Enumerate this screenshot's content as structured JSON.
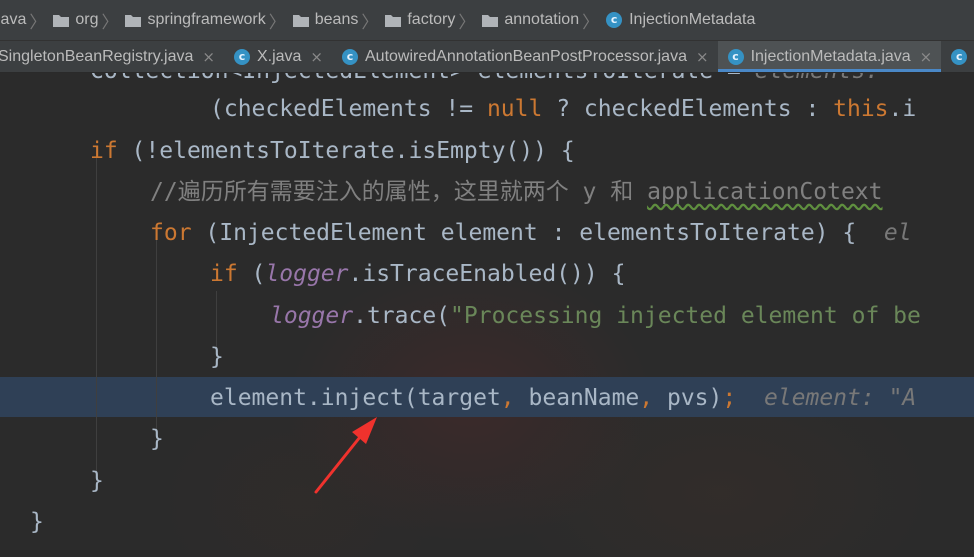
{
  "breadcrumb": {
    "items": [
      {
        "label": "java",
        "icon": "folder-icon"
      },
      {
        "label": "org",
        "icon": "folder-icon"
      },
      {
        "label": "springframework",
        "icon": "folder-icon"
      },
      {
        "label": "beans",
        "icon": "folder-icon"
      },
      {
        "label": "factory",
        "icon": "folder-icon"
      },
      {
        "label": "annotation",
        "icon": "folder-icon"
      },
      {
        "label": "InjectionMetadata",
        "icon": "class-icon"
      }
    ]
  },
  "tabs": [
    {
      "label": "SingletonBeanRegistry.java",
      "close": "×"
    },
    {
      "label": "X.java",
      "close": "×",
      "icon_letter": "c"
    },
    {
      "label": "AutowiredAnnotationBeanPostProcessor.java",
      "close": "×",
      "icon_letter": "c"
    },
    {
      "label": "InjectionMetadata.java",
      "close": "×",
      "icon_letter": "c"
    },
    {
      "label": "",
      "icon_letter": "c"
    }
  ],
  "code": {
    "line1_text": "Collection<InjectedElement> elementsToIterate = ",
    "line1_hint": "elements: ",
    "line2_a": "(checkedElements != ",
    "line2_null": "null",
    "line2_b": " ? checkedElements : ",
    "line2_this": "this",
    "line2_c": ".i",
    "line3_if": "if",
    "line3_rest": " (!elementsToIterate.isEmpty()) {",
    "line4_comment": "//遍历所有需要注入的属性，这里就两个 y 和 ",
    "line4_wavy": "applicationCotext",
    "line5_for": "for",
    "line5_rest": " (InjectedElement element : elementsToIterate) {  ",
    "line5_hint": "el",
    "line6_if": "if",
    "line6_a": " (",
    "line6_logger": "logger",
    "line6_b": ".isTraceEnabled()) {",
    "line7_logger": "logger",
    "line7_a": ".trace(",
    "line7_str": "\"Processing injected element of be",
    "line8": "}",
    "line9_a": "element.inject(target",
    "line9_c1": ",",
    "line9_b": " beanName",
    "line9_c2": ",",
    "line9_c": " pvs)",
    "line9_semi": ";",
    "line9_hint": "  element: \"A",
    "line10": "}",
    "line11": "}",
    "line12": "}"
  },
  "colors": {
    "keyword": "#cc7832",
    "field": "#9876aa",
    "string": "#6a8759",
    "comment": "#808080",
    "text": "#a9b7c6",
    "highlight_line": "#2f4056",
    "annotation_arrow": "#f0322d"
  }
}
